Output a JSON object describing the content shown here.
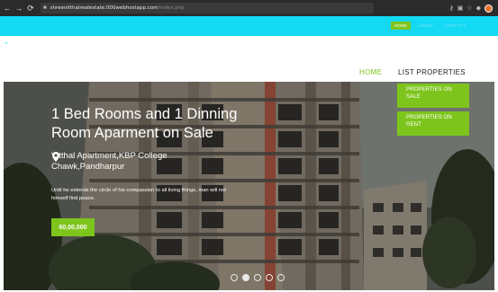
{
  "browser": {
    "url_host": "shreevitthalrealestate.000webhostapp.com",
    "url_path": "/index.php"
  },
  "top_nav": {
    "items": [
      "HOME",
      "ABOUT",
      "CONTACT"
    ]
  },
  "main_nav": {
    "home": "HOME",
    "list_properties": "LIST PROPERTIES"
  },
  "dropdown": {
    "items": [
      "PROPERTIES ON SALE",
      "PROPERTIES ON RENT"
    ]
  },
  "hero": {
    "title": "1 Bed Rooms and 1 Dinning Room Aparment on Sale",
    "location": "Vitthal Apartment,KBP College Chawk,Pandharpur",
    "description": "Until he extends the circle of his compassion to all living things, man will not himself find peace.",
    "price": "60,00,000"
  },
  "carousel": {
    "slide_count": 5,
    "active_index": 1
  },
  "colors": {
    "accent_green": "#7dc51c",
    "top_bar_cyan": "#13d9f2"
  }
}
